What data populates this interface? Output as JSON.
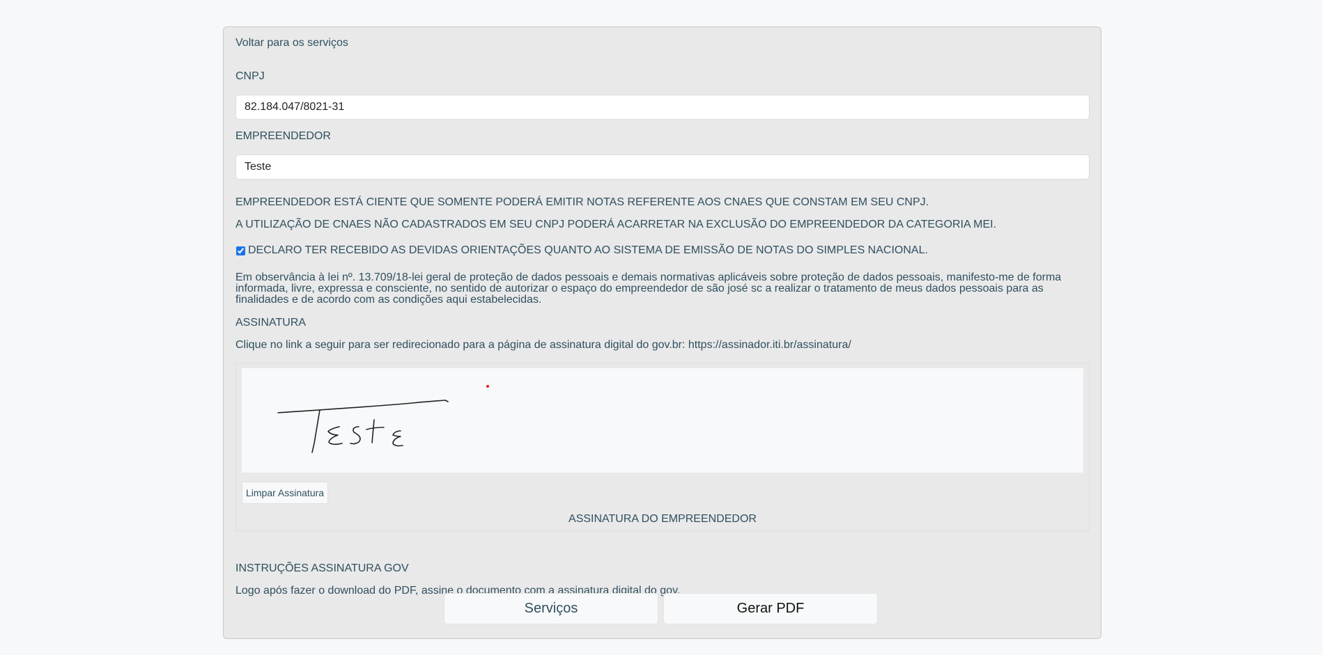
{
  "back_link": "Voltar para os serviços",
  "cnpj": {
    "label": "CNPJ",
    "value": "82.184.047/8021-31"
  },
  "empreendedor": {
    "label": "EMPREENDEDOR",
    "value": "Teste"
  },
  "notices": {
    "cnaes": "EMPREENDEDOR ESTÁ CIENTE QUE SOMENTE PODERÁ EMITIR NOTAS REFERENTE AOS CNAES QUE CONSTAM EM SEU CNPJ.",
    "exclusion": "A UTILIZAÇÃO DE CNAES NÃO CADASTRADOS EM SEU CNPJ PODERÁ ACARRETAR NA EXCLUSÃO DO EMPREENDEDOR DA CATEGORIA MEI."
  },
  "declaration": {
    "checked": true,
    "label": "DECLARO TER RECEBIDO AS DEVIDAS ORIENTAÇÕES QUANTO AO SISTEMA DE EMISSÃO DE NOTAS DO SIMPLES NACIONAL."
  },
  "lgpd_text": "Em observância à lei nº. 13.709/18-lei geral de proteção de dados pessoais e demais normativas aplicáveis sobre proteção de dados pessoais, manifesto-me de forma informada, livre, expressa e consciente, no sentido de autorizar o espaço do empreendedor de são josé sc a realizar o tratamento de meus dados pessoais para as finalidades e de acordo com as condições aqui estabelecidas.",
  "signature": {
    "heading": "ASSINATURA",
    "link_prefix": "Clique no link a seguir para ser redirecionado para a página de assinatura digital do gov.br: ",
    "link_url": "https://assinador.iti.br/assinatura/",
    "clear_button": "Limpar Assinatura",
    "caption": "ASSINATURA DO EMPREENDEDOR",
    "ink_color": "#222222",
    "cursor_dot_color": "#e02020"
  },
  "gov_instructions": {
    "heading": "INSTRUÇÕES ASSINATURA GOV",
    "text": "Logo após fazer o download do PDF, assine o documento com a assinatura digital do gov."
  },
  "buttons": {
    "services": "Serviços",
    "generate_pdf": "Gerar PDF"
  }
}
